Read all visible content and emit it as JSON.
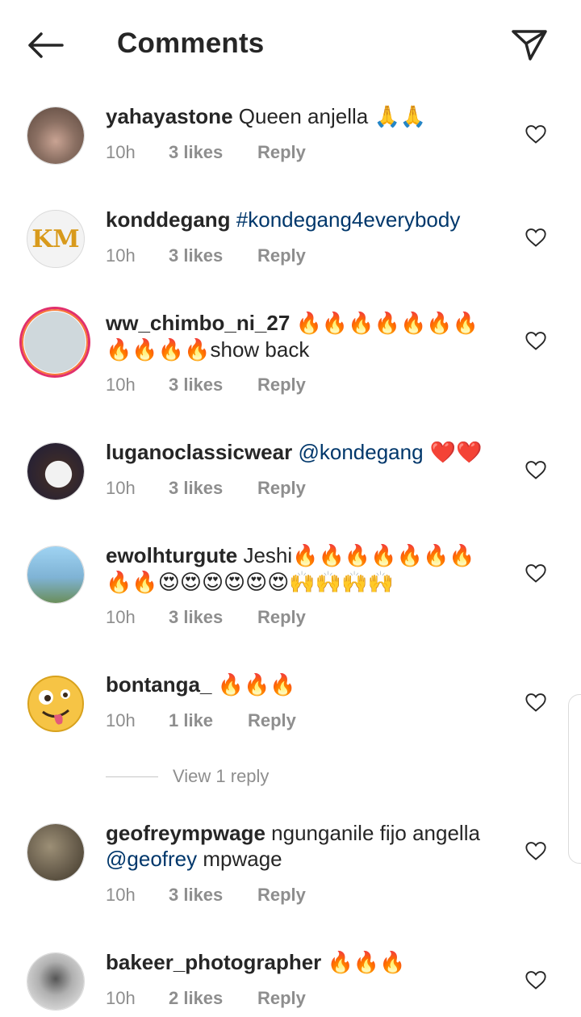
{
  "header": {
    "title": "Comments",
    "back_icon": "arrow-left-icon",
    "send_icon": "paper-plane-icon"
  },
  "comments": [
    {
      "username": "yahayastone",
      "text_before": " Queen anjella ",
      "emoji": "🙏🙏",
      "tag": "",
      "text_after": "",
      "time": "10h",
      "likes": "3 likes",
      "reply": "Reply"
    },
    {
      "username": "konddegang",
      "text_before": " ",
      "emoji": "",
      "tag": "#kondegang4everybody",
      "text_after": "",
      "time": "10h",
      "likes": "3 likes",
      "reply": "Reply"
    },
    {
      "username": "ww_chimbo_ni_27",
      "text_before": " ",
      "emoji": "🔥🔥🔥🔥🔥🔥🔥🔥🔥🔥🔥",
      "tag": "",
      "text_after": "show back",
      "time": "10h",
      "likes": "3 likes",
      "reply": "Reply"
    },
    {
      "username": "luganoclassicwear",
      "text_before": " ",
      "emoji": "",
      "tag": "@kondegang",
      "text_after": " ❤️❤️",
      "time": "10h",
      "likes": "3 likes",
      "reply": "Reply"
    },
    {
      "username": "ewolhturgute",
      "text_before": " Jeshi",
      "emoji": "🔥🔥🔥🔥🔥🔥🔥🔥🔥😍😍😍😍😍😍🙌🙌🙌🙌",
      "tag": "",
      "text_after": "",
      "time": "10h",
      "likes": "3 likes",
      "reply": "Reply"
    },
    {
      "username": "bontanga_",
      "text_before": " ",
      "emoji": "🔥🔥🔥",
      "tag": "",
      "text_after": "",
      "time": "10h",
      "likes": "1 like",
      "reply": "Reply"
    },
    {
      "username": "geofreympwage",
      "text_before": " ngunganile fijo angella ",
      "emoji": "",
      "tag": "@geofrey",
      "text_after": " mpwage",
      "time": "10h",
      "likes": "3 likes",
      "reply": "Reply"
    },
    {
      "username": "bakeer_photographer",
      "text_before": " ",
      "emoji": "🔥🔥🔥",
      "tag": "",
      "text_after": "",
      "time": "10h",
      "likes": "2 likes",
      "reply": "Reply"
    }
  ],
  "view_replies": "View 1 reply",
  "avatar_colors": [
    "#8a6f62",
    "#f3f3f3",
    "#cfd8dc",
    "#2b2b2b",
    "#7fb3d5",
    "#f6c445",
    "#6d6250",
    "#b0b0b0"
  ]
}
